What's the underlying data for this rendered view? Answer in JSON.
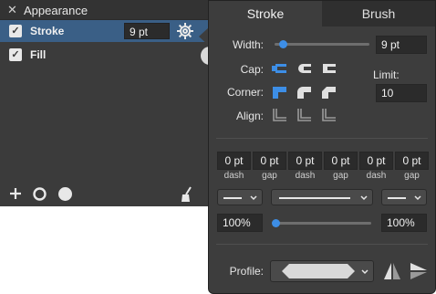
{
  "appearance": {
    "title": "Appearance",
    "close_glyph": "✕",
    "rows": [
      {
        "label": "Stroke",
        "value": "9 pt",
        "checked": true
      },
      {
        "label": "Fill",
        "checked": true
      }
    ],
    "bottom_icons": [
      "add-icon",
      "circle-outline-icon",
      "circle-filled-icon",
      "brush-icon"
    ]
  },
  "popover": {
    "tabs": [
      "Stroke",
      "Brush"
    ],
    "width_label": "Width:",
    "width_value": "9 pt",
    "width_fraction": 0.06,
    "cap_label": "Cap:",
    "corner_label": "Corner:",
    "align_label": "Align:",
    "limit_label": "Limit:",
    "limit_value": "10",
    "dash_values": [
      "0 pt",
      "0 pt",
      "0 pt",
      "0 pt",
      "0 pt",
      "0 pt"
    ],
    "dash_labels": [
      "dash",
      "gap",
      "dash",
      "gap",
      "dash",
      "gap"
    ],
    "start_percent": "100%",
    "end_percent": "100%",
    "percent_slider_fraction": 0.0,
    "profile_label": "Profile:"
  },
  "colors": {
    "accent": "#3d8ee6",
    "selected_row": "#3a5f86",
    "panel": "#3b3b3b",
    "popover": "#3d3d3d"
  }
}
